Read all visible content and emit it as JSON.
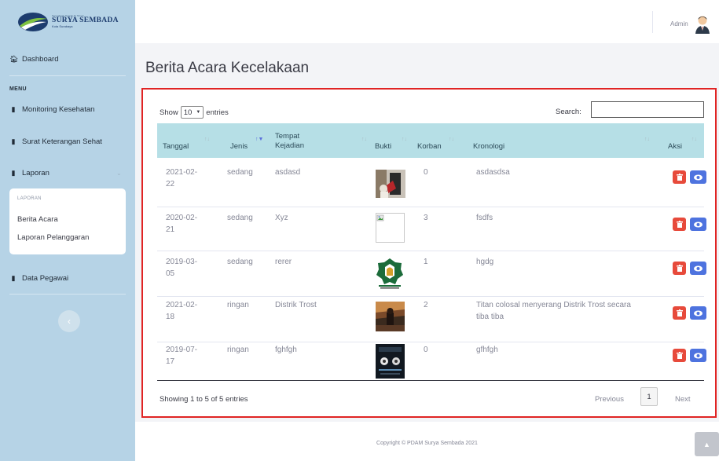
{
  "brand": {
    "tagline": "Perusahaan Daerah Air Minum",
    "name": "SURYA SEMBADA",
    "city": "Kota Surabaya"
  },
  "sidebar": {
    "dashboard": "Dashboard",
    "menu_heading": "MENU",
    "items": [
      {
        "label": "Monitoring Kesehatan",
        "icon": "clipboard-icon"
      },
      {
        "label": "Surat Keterangan Sehat",
        "icon": "clipboard-icon"
      },
      {
        "label": "Laporan",
        "icon": "clipboard-icon"
      },
      {
        "label": "Data Pegawai",
        "icon": "clipboard-icon"
      }
    ],
    "submenu_heading": "LAPORAN",
    "submenu": [
      "Berita Acara",
      "Laporan Pelanggaran"
    ]
  },
  "topbar": {
    "user": "Admin"
  },
  "page": {
    "title": "Berita Acara Kecelakaan"
  },
  "table_controls": {
    "show": "Show",
    "entries_value": "10",
    "entries": "entries",
    "search_label": "Search:",
    "search_value": ""
  },
  "table": {
    "columns": [
      "Tanggal",
      "Jenis",
      "Tempat\nKejadian",
      "Bukti",
      "Korban",
      "Kronologi",
      "Aksi"
    ],
    "rows": [
      {
        "tanggal": "2021-02-\n22",
        "jenis": "sedang",
        "tempat": "asdasd",
        "bukti": "photo",
        "korban": "0",
        "kronologi": "asdasdsa"
      },
      {
        "tanggal": "2020-02-\n21",
        "jenis": "sedang",
        "tempat": "Xyz",
        "bukti": "broken-image",
        "korban": "3",
        "kronologi": "fsdfs"
      },
      {
        "tanggal": "2019-03-\n05",
        "jenis": "sedang",
        "tempat": "rerer",
        "bukti": "logo",
        "korban": "1",
        "kronologi": "hgdg"
      },
      {
        "tanggal": "2021-02-\n18",
        "jenis": "ringan",
        "tempat": "Distrik Trost",
        "bukti": "photo",
        "korban": "2",
        "kronologi": "Titan colosal menyerang Distrik Trost secara\ntiba tiba"
      },
      {
        "tanggal": "2019-07-\n17",
        "jenis": "ringan",
        "tempat": "fghfgh",
        "bukti": "poster",
        "korban": "0",
        "kronologi": "gfhfgh"
      }
    ]
  },
  "pagination": {
    "info": "Showing 1 to 5 of 5 entries",
    "previous": "Previous",
    "current": "1",
    "next": "Next"
  },
  "footer": {
    "copyright": "Copyright © PDAM Surya Sembada 2021"
  },
  "colors": {
    "sidebar": "#b6d3e6",
    "header": "#b6dfe6",
    "danger": "#e74a3b",
    "primary": "#4e73df",
    "highlight_border": "#e02424"
  }
}
